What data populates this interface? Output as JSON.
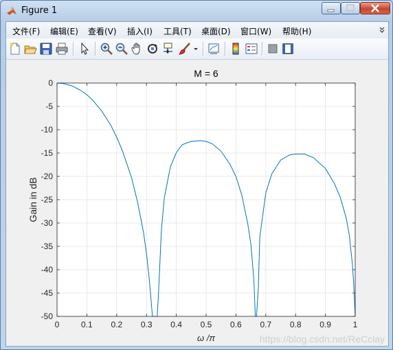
{
  "window": {
    "title": "Figure 1"
  },
  "menu": {
    "items": [
      "文件(F)",
      "编辑(E)",
      "查看(V)",
      "插入(I)",
      "工具(T)",
      "桌面(D)",
      "窗口(W)",
      "帮助(H)"
    ],
    "overflow_icon": "chevron-icon"
  },
  "toolbar": {
    "icons": [
      "new-figure-icon",
      "open-file-icon",
      "save-icon",
      "print-icon",
      "pointer-icon",
      "zoom-in-icon",
      "zoom-out-icon",
      "pan-icon",
      "rotate-3d-icon",
      "data-cursor-icon",
      "brush-icon",
      "brush-dropdown-icon",
      "link-plot-icon",
      "colorbar-icon",
      "legend-icon",
      "hide-plot-tools-icon",
      "show-plot-tools-icon"
    ]
  },
  "watermark": "https://blog.csdn.net/ReCclay",
  "chart_data": {
    "type": "line",
    "title": "M = 6",
    "xlabel": "ω /π",
    "ylabel": "Gain in dB",
    "xlim": [
      0,
      1
    ],
    "ylim": [
      -50,
      0
    ],
    "xticks": [
      "0",
      "0.1",
      "0.2",
      "0.3",
      "0.4",
      "0.5",
      "0.6",
      "0.7",
      "0.8",
      "0.9",
      "1"
    ],
    "yticks": [
      "0",
      "-5",
      "-10",
      "-15",
      "-20",
      "-25",
      "-30",
      "-35",
      "-40",
      "-45",
      "-50"
    ],
    "grid": true,
    "line_color": "#0072bd",
    "series": [
      {
        "x": [
          0,
          0.02,
          0.05,
          0.08,
          0.1,
          0.12,
          0.15,
          0.18,
          0.2,
          0.22,
          0.25,
          0.27,
          0.29,
          0.3,
          0.31,
          0.32,
          0.325,
          0.33,
          0.333,
          0.336,
          0.34,
          0.35,
          0.36,
          0.38,
          0.4,
          0.42,
          0.45,
          0.48,
          0.5,
          0.52,
          0.55,
          0.58,
          0.6,
          0.62,
          0.64,
          0.65,
          0.66,
          0.665,
          0.667,
          0.669,
          0.675,
          0.68,
          0.7,
          0.72,
          0.75,
          0.78,
          0.8,
          0.83,
          0.86,
          0.9,
          0.93,
          0.95,
          0.97,
          0.98,
          0.99,
          0.995,
          1.0
        ],
        "y": [
          0,
          -0.1,
          -0.6,
          -1.6,
          -2.5,
          -3.7,
          -6.0,
          -9.0,
          -11.6,
          -14.6,
          -20.3,
          -25.5,
          -32.0,
          -36.5,
          -42.5,
          -50,
          -50,
          -50,
          -50,
          -50,
          -45.5,
          -31.5,
          -24.5,
          -18.0,
          -14.9,
          -13.2,
          -12.5,
          -12.35,
          -12.5,
          -13.0,
          -14.6,
          -17.4,
          -20.0,
          -24.1,
          -30.3,
          -34.5,
          -42.0,
          -50,
          -50,
          -50,
          -44.0,
          -33.0,
          -23.6,
          -19.5,
          -16.5,
          -15.4,
          -15.2,
          -15.2,
          -16.0,
          -18.3,
          -21.5,
          -24.5,
          -29.0,
          -32.5,
          -38.5,
          -43.0,
          -50
        ]
      }
    ]
  }
}
